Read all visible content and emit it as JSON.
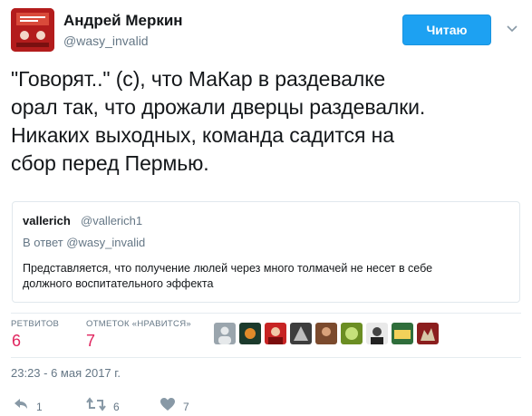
{
  "author": {
    "name": "Андрей Меркин",
    "handle": "@wasy_invalid"
  },
  "follow_button": {
    "label": "Читаю"
  },
  "tweet": {
    "text_lines": [
      "\"Говорят..\" (с), что МаКар в раздевалке",
      "орал так, что дрожали дверцы раздевалки.",
      "Никаких выходных, команда садится на",
      "сбор перед Пермью."
    ]
  },
  "quote": {
    "name": "vallerich",
    "handle": "@vallerich1",
    "reply_to": "В ответ @wasy_invalid",
    "text_lines": [
      "Представляется, что получение люлей через много толмачей не несет в себе",
      "должного воспитательного эффекта"
    ]
  },
  "stats": {
    "retweets_label": "РЕТВИТОВ",
    "retweets_value": "6",
    "likes_label": "ОТМЕТОК «НРАВИТСЯ»",
    "likes_value": "7"
  },
  "timestamp": "23:23 - 6 мая 2017 г.",
  "actions": {
    "reply_count": "1",
    "retweet_count": "6",
    "like_count": "7"
  },
  "colors": {
    "accent": "#1da1f2",
    "like": "#e0245e",
    "muted": "#657786"
  }
}
